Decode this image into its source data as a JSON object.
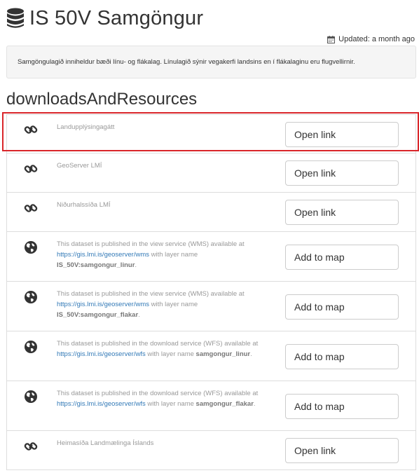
{
  "page": {
    "title": "IS 50V Samgöngur",
    "updated": "Updated: a month ago",
    "abstract": "Samgöngulagið inniheldur bæði línu- og flákalag. Línulagið sýnir vegakerfi landsins en í flákalaginu eru flugvellirnir.",
    "section_heading": "downloadsAndResources"
  },
  "resources": [
    {
      "icon": "link-icon",
      "name": "Landupplýsingagátt",
      "button": "Open link"
    },
    {
      "icon": "link-icon",
      "name": "GeoServer LMÍ",
      "button": "Open link"
    },
    {
      "icon": "link-icon",
      "name": "Niðurhalssíða LMÍ",
      "button": "Open link"
    },
    {
      "icon": "globe-icon",
      "pre": "This dataset is published in the view service (WMS) available at ",
      "url": "https://gis.lmi.is/geoserver/wms",
      "mid": " with layer name ",
      "layer": "IS_50V:samgongur_linur",
      "post": ".",
      "button": "Add to map"
    },
    {
      "icon": "globe-icon",
      "pre": "This dataset is published in the view service (WMS) available at ",
      "url": "https://gis.lmi.is/geoserver/wms",
      "mid": " with layer name ",
      "layer": "IS_50V:samgongur_flakar",
      "post": ".",
      "button": "Add to map"
    },
    {
      "icon": "globe-icon",
      "pre": "This dataset is published in the download service (WFS) available at ",
      "url": "https://gis.lmi.is/geoserver/wfs",
      "mid": " with layer name ",
      "layer": "samgongur_linur",
      "post": ".",
      "button": "Add to map"
    },
    {
      "icon": "globe-icon",
      "pre": "This dataset is published in the download service (WFS) available at ",
      "url": "https://gis.lmi.is/geoserver/wfs",
      "mid": " with layer name ",
      "layer": "samgongur_flakar",
      "post": ".",
      "button": "Add to map"
    },
    {
      "icon": "link-icon",
      "name": "Heimasíða Landmælinga Íslands",
      "button": "Open link"
    }
  ],
  "colors": {
    "link": "#337ab7",
    "highlight": "#d9262a",
    "muted": "#999999"
  }
}
